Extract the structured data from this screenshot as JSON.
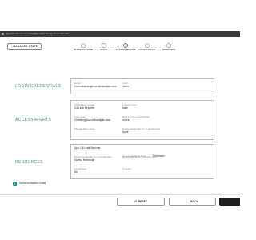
{
  "browser": {
    "url": "https://business.ca.mekanalytic.com/manager/userstate/add"
  },
  "header": {
    "back_button": "MANAGER STATE"
  },
  "stepper": {
    "steps": [
      {
        "label": "INTRODUCTION",
        "active": false
      },
      {
        "label": "EMAIL",
        "active": false
      },
      {
        "label": "ACCESS RIGHTS",
        "active": true
      },
      {
        "label": "RESOURCES",
        "active": false
      },
      {
        "label": "OVERVIEW",
        "active": false
      }
    ]
  },
  "login": {
    "title": "LOGIN CREDENTIALS",
    "email_label": "Email",
    "email_value": "m.modeamangie.ca.mekanalytic.com",
    "login_label": "Login",
    "login_value": "mlem"
  },
  "access": {
    "title": "ACCESS RIGHTS",
    "app_license_label": "Application License",
    "app_license_value": "C4 Leak Reporter",
    "license_type_label": "License Type",
    "license_type_value": "base",
    "supervisor_label": "Supervisor",
    "supervisor_value": "CMeeting@ca.mekanalytic.com",
    "rights_manager_label": "Rights of a m.ausherstate",
    "rights_manager_value": "Users",
    "manageable_users_label": "Manageable Users",
    "manageable_users_value": "",
    "rights_assignable_label": "Rights assignable by m.ausherstate",
    "rights_assignable_value": "None"
  },
  "resources": {
    "title": "RESOURCES",
    "app_label": "App: C4 Leak Reporter",
    "role_label": "In m.ausherstate Role:",
    "role_value": "Technician",
    "roles_assignable_label": "Roles assignable by m.ausherstate",
    "roles_assignable_value": "Guest, Technician",
    "roles_editable_label": "Roles editable by m.ausherstate",
    "roles_editable_value": "",
    "companies_label": "Companies",
    "companies_value": "All",
    "projects_label": "Projects",
    "projects_value": ""
  },
  "invite": {
    "checked": true,
    "label": "Send invitation email"
  },
  "footer": {
    "reset_label": "RESET",
    "back_label": "BACK",
    "accent": "#2e8b8b"
  }
}
